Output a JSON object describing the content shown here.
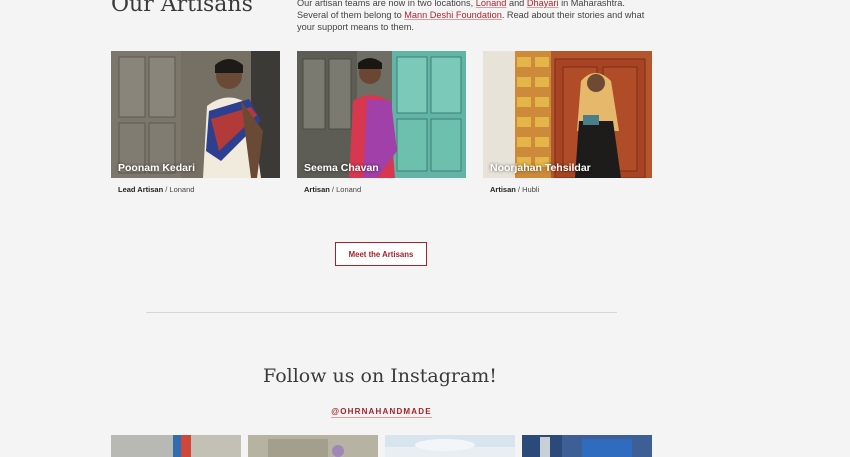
{
  "section": {
    "title": "Our Artisans",
    "intro_before": "Our artisan teams are now in two locations, ",
    "link_lonand": "Lonand",
    "intro_and": " and ",
    "link_dhayari": "Dhayari",
    "intro_mid": " in Maharashtra. Several of them belong to ",
    "link_mann": "Mann Deshi Foundation",
    "intro_after": ". Read about their stories and what your support means to them."
  },
  "artisans": [
    {
      "name": "Poonam Kedari",
      "role": "Lead Artisan",
      "location": "Lonand"
    },
    {
      "name": "Seema Chavan",
      "role": "Artisan",
      "location": "Lonand"
    },
    {
      "name": "Noorjahan Tehsildar",
      "role": "Artisan",
      "location": "Hubli"
    }
  ],
  "separator": " / ",
  "meet_button": "Meet the Artisans",
  "instagram": {
    "title": "Follow us on Instagram!",
    "handle": "@OHRNAHANDMADE"
  }
}
